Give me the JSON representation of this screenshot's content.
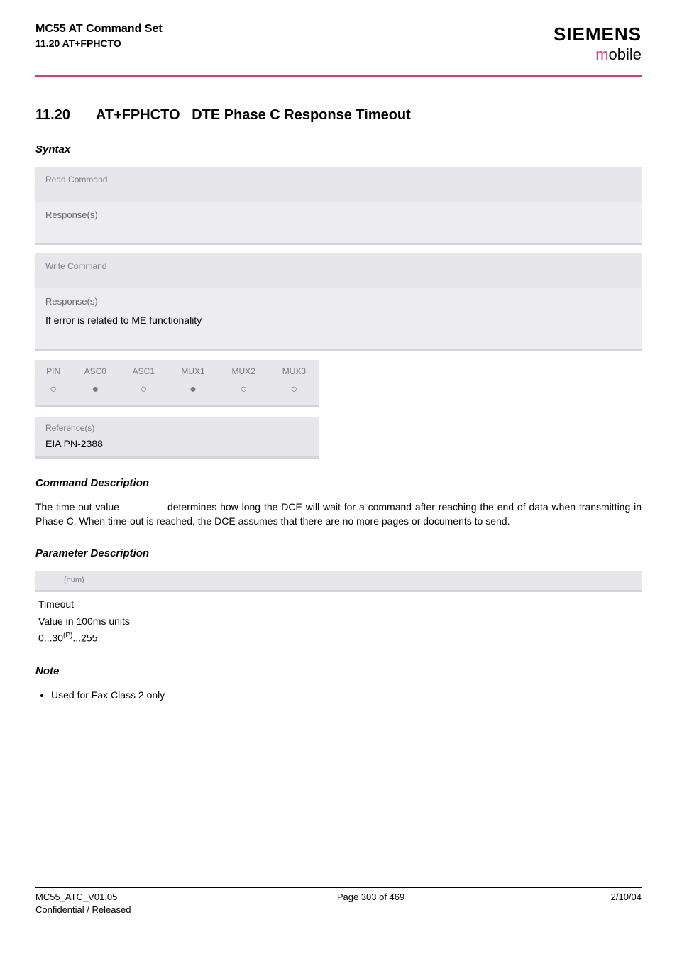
{
  "header": {
    "product": "MC55 AT Command Set",
    "section_ref": "11.20 AT+FPHCTO",
    "brand": "SIEMENS",
    "brand_sub_m": "m",
    "brand_sub_rest": "obile"
  },
  "title": {
    "num": "11.20",
    "cmd": "AT+FPHCTO",
    "desc": "DTE Phase C Response Timeout"
  },
  "syntax_label": "Syntax",
  "blocks": {
    "read_cmd_label": "Read Command",
    "response_label": "Response(s)",
    "write_cmd_label": "Write Command",
    "me_error_text": "If error is related to ME functionality"
  },
  "matrix": {
    "headers": [
      "PIN",
      "ASC0",
      "ASC1",
      "MUX1",
      "MUX2",
      "MUX3"
    ],
    "values": [
      "○",
      "●",
      "○",
      "●",
      "○",
      "○"
    ]
  },
  "reference": {
    "label": "Reference(s)",
    "value": "EIA PN-2388"
  },
  "cmd_desc": {
    "heading": "Command Description",
    "text_pre": "The time-out value ",
    "text_post": " determines how long the DCE will wait for a command after reaching the end of data when transmitting in Phase C. When time-out is reached, the DCE assumes that there are no more pages or documents to send."
  },
  "param": {
    "heading": "Parameter Description",
    "tag": "(num)",
    "l1": "Timeout",
    "l2": "Value in 100ms units",
    "l3_pre": "0...30",
    "l3_sup": "(P)",
    "l3_post": "...255"
  },
  "note": {
    "heading": "Note",
    "item": "Used for Fax Class 2 only"
  },
  "footer": {
    "left1": "MC55_ATC_V01.05",
    "left2": "Confidential / Released",
    "center": "Page 303 of 469",
    "right": "2/10/04"
  }
}
